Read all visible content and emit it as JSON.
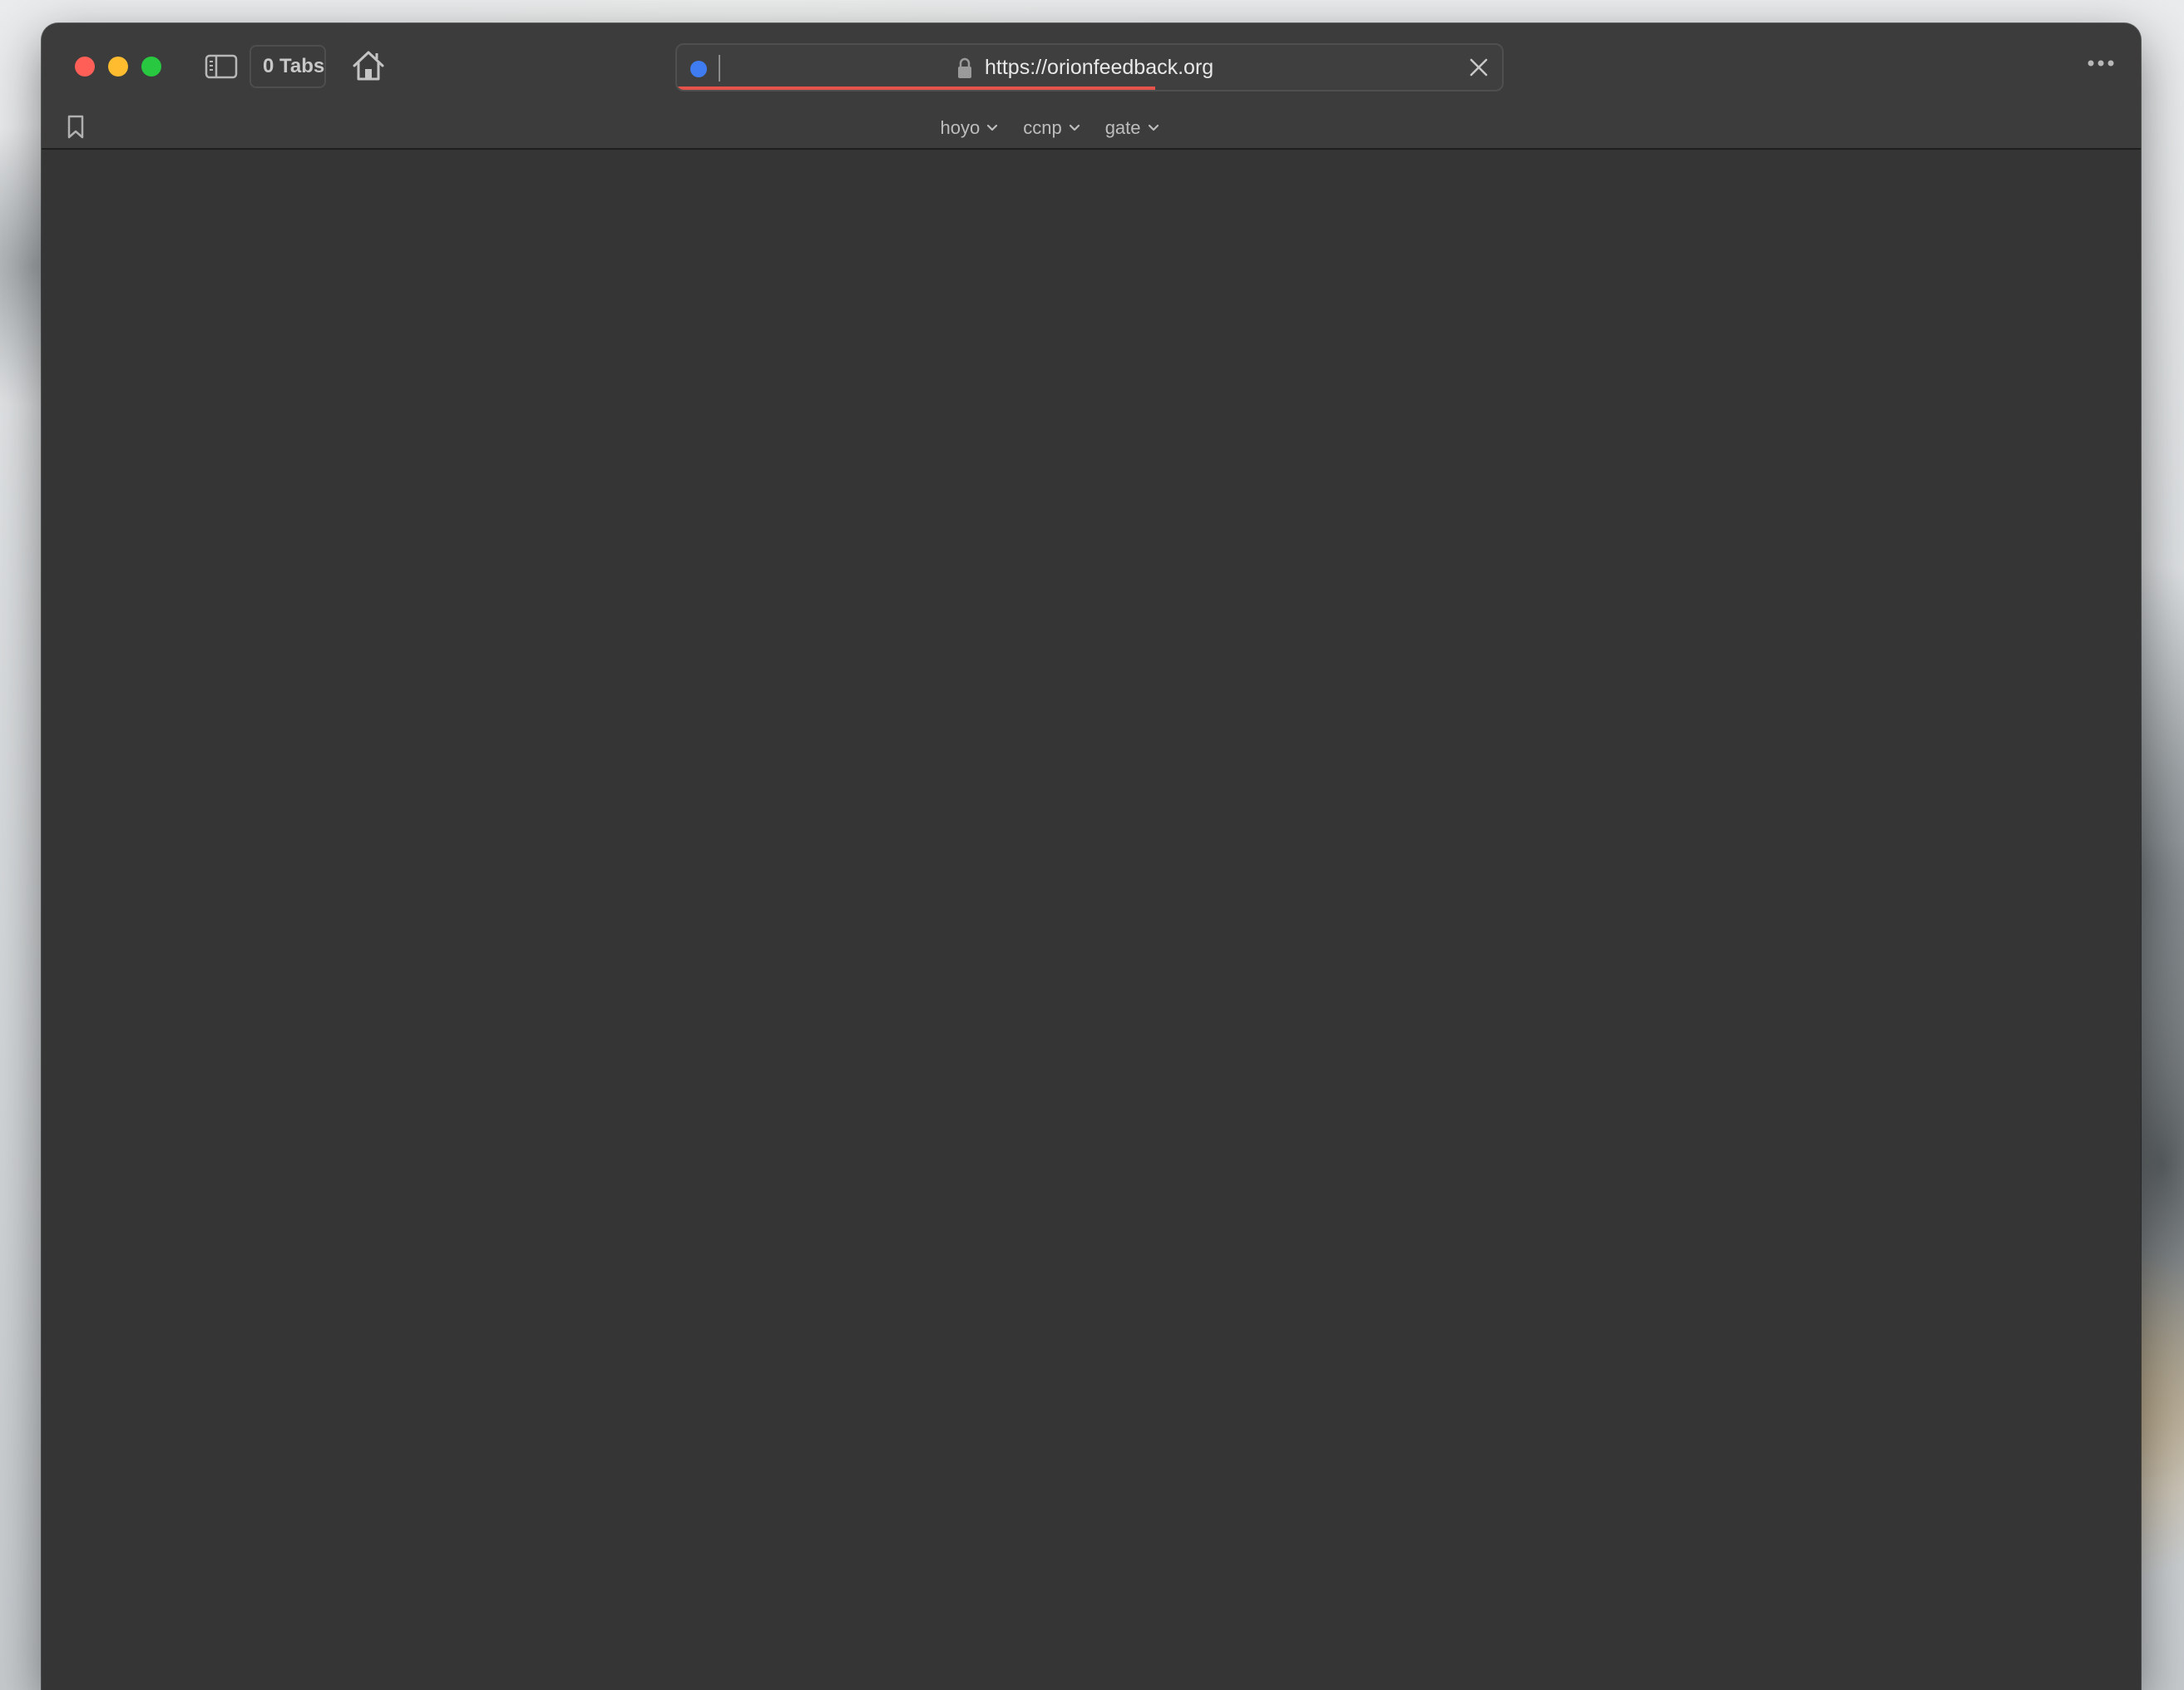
{
  "window": {
    "tabs_label": "0 Tabs",
    "url": "https://orionfeedback.org",
    "load_progress": 0.58
  },
  "bookmarks_bar": {
    "folders": [
      {
        "label": "hoyo"
      },
      {
        "label": "ccnp"
      },
      {
        "label": "gate"
      }
    ]
  },
  "colors": {
    "close": "#ff5f57",
    "minimize": "#febc2e",
    "maximize": "#28c840",
    "accent_dot": "#3f7cf2",
    "progress": "#e5534b",
    "content_bg": "#353535"
  },
  "icons": [
    "sidebar-icon",
    "home-icon",
    "lock-icon",
    "close-icon",
    "more-icon",
    "bookmark-icon",
    "chevron-down-icon"
  ]
}
